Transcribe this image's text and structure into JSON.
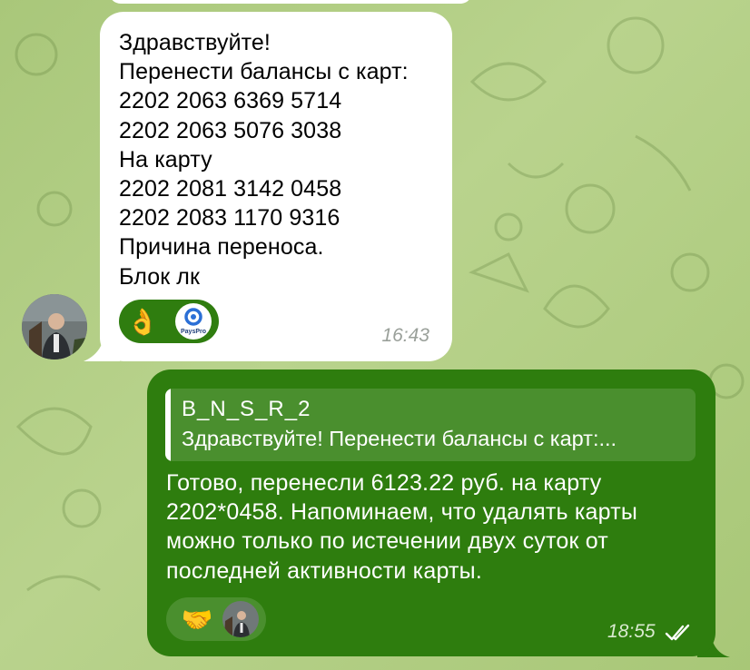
{
  "incoming_message": {
    "text": "Здравствуйте!\nПеренести балансы с карт:\n2202 2063 6369 5714\n2202 2063 5076 3038\nНа карту\n2202 2081 3142 0458\n2202 2083 1170 9316\nПричина переноса.\nБлок лк",
    "time": "16:43",
    "reactions": [
      {
        "emoji": "👌",
        "icon": "ok-hand-icon"
      },
      {
        "label": "PaysPro",
        "icon": "payspro-avatar-icon"
      }
    ]
  },
  "outgoing_message": {
    "reply_author": "B_N_S_R_2",
    "reply_quote": "Здравствуйте! Перенести балансы с карт:...",
    "text": "Готово, перенесли 6123.22 руб. на карту\n2202*0458. Напоминаем, что удалять карты\nможно только по истечении двух суток от\nпоследней активности карты.",
    "time": "18:55",
    "status_icon": "double-check-icon",
    "reactions": [
      {
        "emoji": "🤝",
        "icon": "handshake-icon"
      },
      {
        "icon": "user-avatar-icon"
      }
    ]
  },
  "colors": {
    "outgoing_bubble": "#2e7d0e",
    "incoming_bubble": "#ffffff",
    "wallpaper": "#b0cd82"
  }
}
